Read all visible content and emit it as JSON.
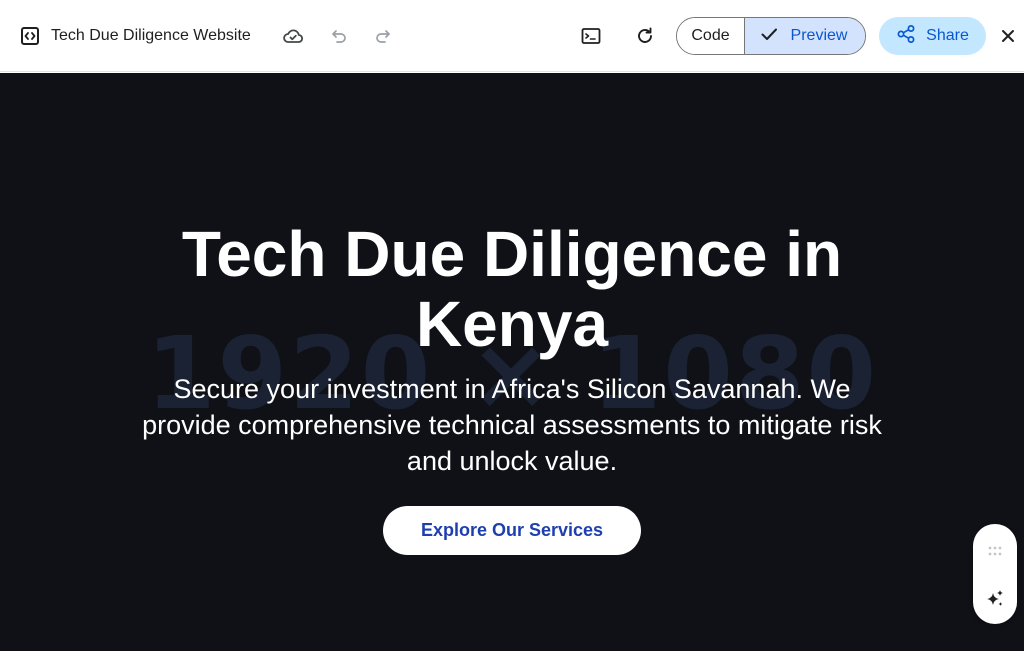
{
  "toolbar": {
    "title": "Tech Due Diligence Website",
    "code_label": "Code",
    "preview_label": "Preview",
    "share_label": "Share",
    "icons": {
      "app": "code-window-icon",
      "cloud": "cloud-check-icon",
      "undo": "undo-icon",
      "redo": "redo-icon",
      "terminal": "terminal-icon",
      "refresh": "refresh-icon",
      "check": "check-icon",
      "share": "share-icon",
      "close": "close-icon"
    }
  },
  "preview": {
    "placeholder": "1920 × 1080",
    "hero": {
      "title": "Tech Due Diligence in Kenya",
      "subtitle": "Secure your investment in Africa's Silicon Savannah. We provide comprehensive technical assessments to mitigate risk and unlock value.",
      "cta_label": "Explore Our Services"
    },
    "float_panel": {
      "icons": [
        "drag-handle-icon",
        "sparkle-icon"
      ]
    }
  },
  "colors": {
    "preview_bg": "#0f1117",
    "accent_blue": "#0b57d0",
    "preview_pill": "#d3e3fd",
    "share_bg": "#c2e7ff",
    "cta_text": "#1e40af"
  }
}
